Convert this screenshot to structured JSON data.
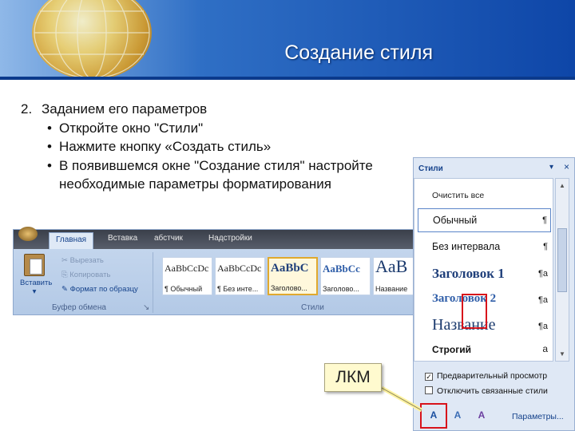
{
  "slide": {
    "title": "Создание стиля",
    "step": "2.",
    "heading": "Заданием его параметров",
    "bullets": [
      "Откройте окно \"Стили\"",
      "Нажмите кнопку «Создать стиль»",
      "В появившемся окне \"Создание стиля\" настройте"
    ],
    "bullet_continuation": "необходимые параметры форматирования",
    "callout": "ЛКМ",
    "accent_color": "#0e46a8",
    "highlight_color": "#d8131b"
  },
  "ribbon": {
    "tabs": [
      "Главная",
      "Вставка",
      "абстчик",
      "Надстройки"
    ],
    "clipboard": {
      "paste_label": "Вставить",
      "paste_arrow": "▾",
      "cut": "Вырезать",
      "copy": "Копировать",
      "format_painter": "Формат по образцу",
      "group_name": "Буфер обмена",
      "launcher": "↘"
    },
    "style_samples": [
      {
        "sample": "AaBbCcDc",
        "name": "¶ Обычный"
      },
      {
        "sample": "AaBbCcDc",
        "name": "¶ Без инте..."
      },
      {
        "sample": "AaBbC",
        "name": "Заголово..."
      },
      {
        "sample": "AaBbCc",
        "name": "Заголово..."
      },
      {
        "sample": "AaB",
        "name": "Название"
      }
    ],
    "styles_group_name": "Стили"
  },
  "styles_pane": {
    "title": "Стили",
    "dropdown_glyph": "▾",
    "close_glyph": "×",
    "items": [
      {
        "label": "Очистить все",
        "marker": ""
      },
      {
        "label": "Обычный",
        "marker": "¶"
      },
      {
        "label": "Без интервала",
        "marker": "¶"
      },
      {
        "label": "Заголовок 1",
        "marker": "¶a"
      },
      {
        "label": "Заголовок 2",
        "marker": "¶a"
      },
      {
        "label": "Название",
        "marker": "¶a"
      },
      {
        "label": "Строгий",
        "marker": "a"
      }
    ],
    "preview_checkbox": "Предварительный просмотр",
    "linked_checkbox": "Отключить связанные стили",
    "check_mark": "✓",
    "buttons": [
      {
        "icon": "new-style-icon",
        "glyph": "A"
      },
      {
        "icon": "style-inspector-icon",
        "glyph": "A"
      },
      {
        "icon": "manage-styles-icon",
        "glyph": "A"
      }
    ],
    "params_link": "Параметры...",
    "scroll_up": "▲",
    "scroll_down": "▼"
  }
}
